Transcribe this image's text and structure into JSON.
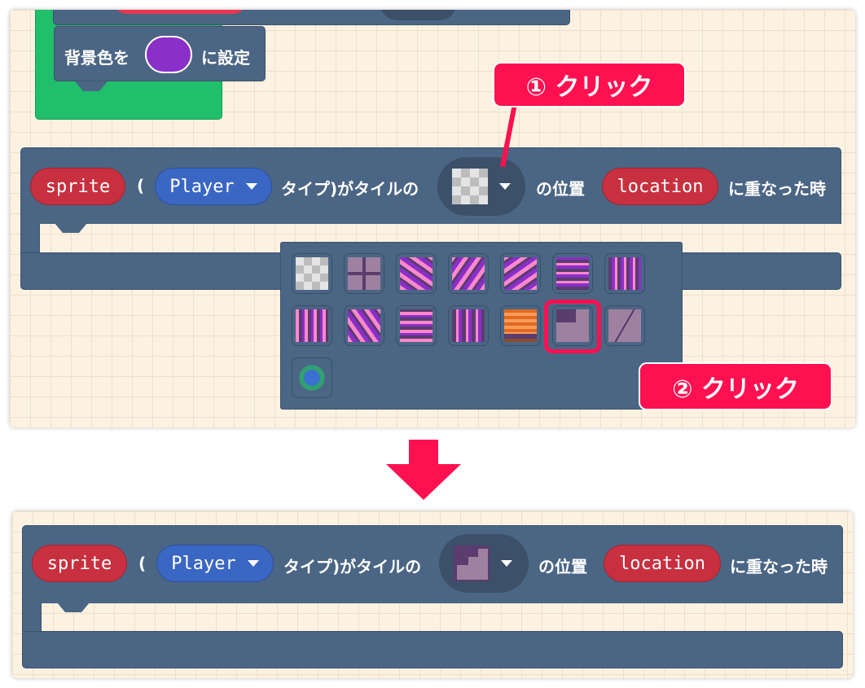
{
  "top_panel": {
    "set_bg_block": {
      "prefix": "背景色を",
      "suffix": "に設定",
      "color": "#8b2fc9"
    },
    "event_block": {
      "sprite_label": "sprite",
      "open_paren": "(",
      "kind": "Player",
      "text1": "タイプ)がタイルの",
      "selected_tile": "transparent-tile",
      "text2": "の位置",
      "location_label": "location",
      "text3": "に重なった時"
    },
    "tile_menu": {
      "tiles": [
        "transparent",
        "stone-cross",
        "purple-brick-diag-1",
        "purple-brick-diag-2",
        "purple-brick-diag-3",
        "purple-brick-horizontal",
        "purple-brick-vertical",
        "purple-brick-vertical-2",
        "purple-brick-diag-4",
        "purple-brick-horizontal-2",
        "purple-brick-vertical-3",
        "orange-chest",
        "stairs",
        "cracked-stone",
        "globe"
      ],
      "highlighted_index": 12
    },
    "callout1": "① クリック",
    "callout2": "② クリック"
  },
  "bottom_panel": {
    "event_block": {
      "sprite_label": "sprite",
      "open_paren": "(",
      "kind": "Player",
      "text1": "タイプ)がタイルの",
      "selected_tile": "stairs",
      "text2": "の位置",
      "location_label": "location",
      "text3": "に重なった時"
    }
  },
  "colors": {
    "accent": "#ff1050",
    "block": "#4b6584",
    "green": "#20bf6b",
    "sprite": "#c8303f",
    "kind": "#3a66c4"
  }
}
